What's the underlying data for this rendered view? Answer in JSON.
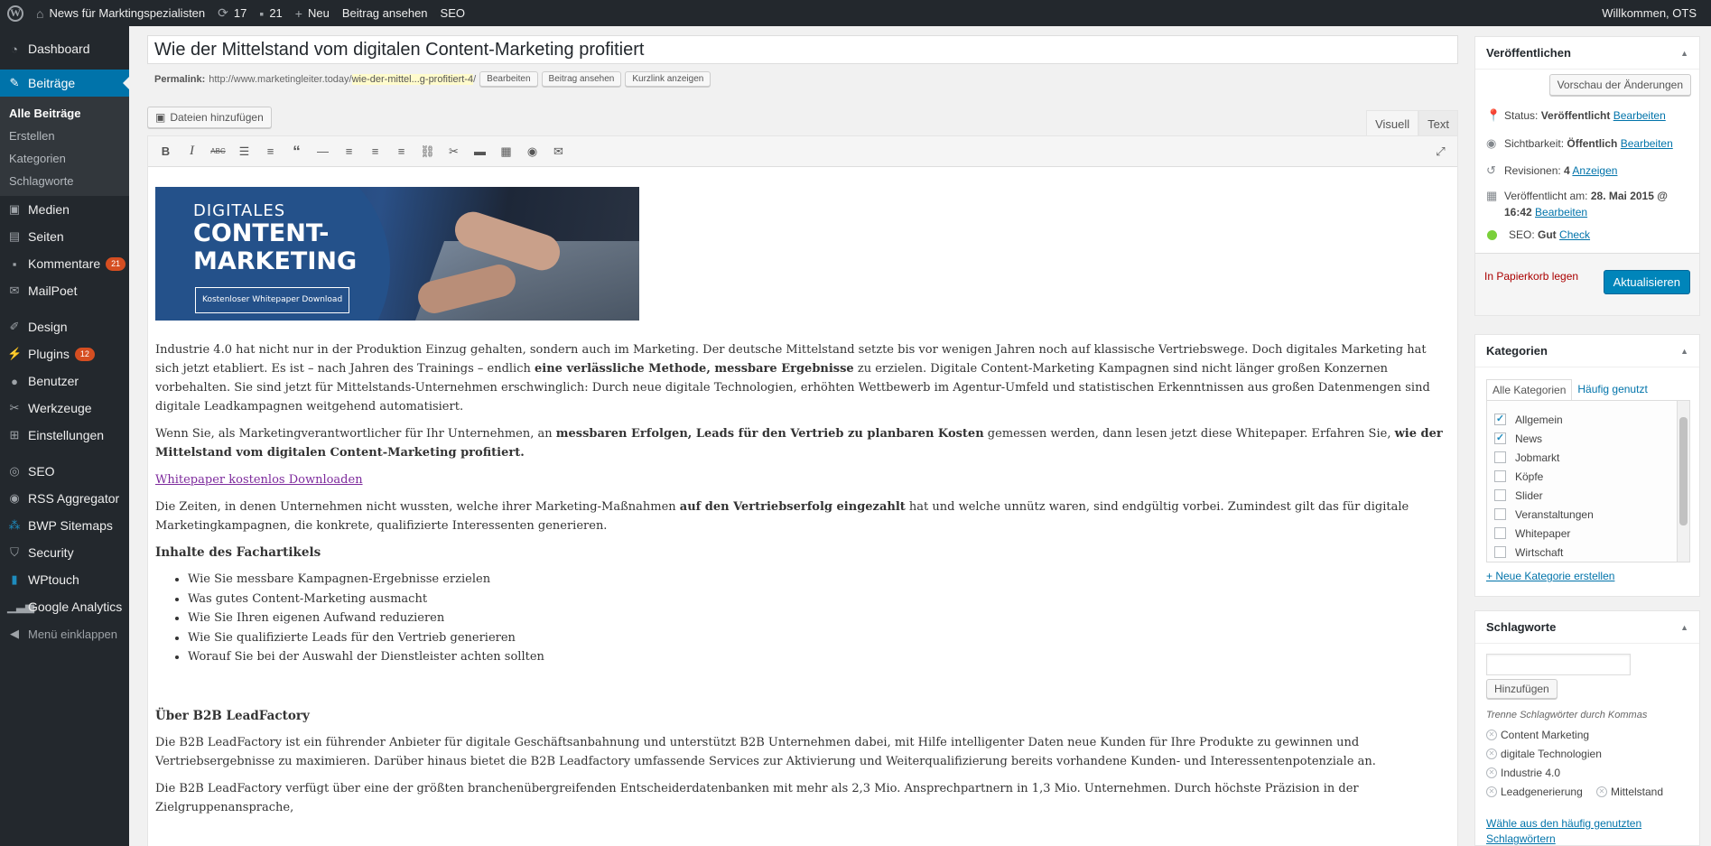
{
  "adminbar": {
    "site_name": "News für Marktingspezialisten",
    "updates_count": "17",
    "comments_count": "21",
    "new_label": "Neu",
    "view_post_label": "Beitrag ansehen",
    "seo_label": "SEO",
    "greeting": "Willkommen, OTS"
  },
  "sidebar": {
    "dashboard": "Dashboard",
    "posts": "Beiträge",
    "posts_sub": [
      "Alle Beiträge",
      "Erstellen",
      "Kategorien",
      "Schlagworte"
    ],
    "media": "Medien",
    "pages": "Seiten",
    "comments": "Kommentare",
    "comments_badge": "21",
    "mailpoet": "MailPoet",
    "design": "Design",
    "plugins": "Plugins",
    "plugins_badge": "12",
    "users": "Benutzer",
    "tools": "Werkzeuge",
    "settings": "Einstellungen",
    "seo": "SEO",
    "rss": "RSS Aggregator",
    "bwp": "BWP Sitemaps",
    "security": "Security",
    "wptouch": "WPtouch",
    "analytics": "Google Analytics",
    "collapse": "Menü einklappen"
  },
  "editor": {
    "title": "Wie der Mittelstand vom digitalen Content-Marketing profitiert",
    "permalink_label": "Permalink:",
    "permalink_base": "http://www.marketingleiter.today/",
    "permalink_slug": "wie-der-mittel...g-profitiert-4",
    "permalink_end": "/",
    "edit_btn": "Bearbeiten",
    "view_btn": "Beitrag ansehen",
    "shortlink_btn": "Kurzlink anzeigen",
    "add_media": "Dateien hinzufügen",
    "tab_visual": "Visuell",
    "tab_text": "Text"
  },
  "banner": {
    "line1": "DIGITALES",
    "line2": "CONTENT-",
    "line3": "MARKETING",
    "button": "Kostenloser Whitepaper Download"
  },
  "content": {
    "p1": "Industrie 4.0 hat nicht nur in der Produktion Einzug gehalten, sondern auch im Marketing. Der deutsche Mittelstand setzte bis vor wenigen Jahren noch auf klassische Vertriebswege. Doch digitales Marketing hat sich jetzt etabliert. Es ist – nach Jahren des Trainings – endlich ",
    "p1_bold": "eine verlässliche Methode, messbare Ergebnisse",
    "p1_end": " zu erzielen.  Digitale Content-Marketing Kampagnen sind nicht länger großen Konzernen vorbehalten. Sie sind jetzt für Mittelstands-Unternehmen erschwinglich: Durch neue digitale Technologien, erhöhten Wettbewerb im Agentur-Umfeld und statistischen Erkenntnissen aus großen Datenmengen sind digitale Leadkampagnen weitgehend automatisiert.",
    "p2_start": "Wenn Sie, als Marketingverantwortlicher für Ihr Unternehmen, an ",
    "p2_bold1": "messbaren Erfolgen, Leads für den Vertrieb zu planbaren Kosten",
    "p2_mid": " gemessen werden, dann lesen jetzt diese Whitepaper. Erfahren Sie, ",
    "p2_bold2": "wie der Mittelstand vom digitalen Content-Marketing profitiert.",
    "download_link": "Whitepaper kostenlos Downloaden",
    "p3_start": "Die Zeiten, in denen Unternehmen nicht wussten, welche ihrer Marketing-Maßnahmen ",
    "p3_bold": "auf den Vertriebserfolg eingezahlt",
    "p3_end": " hat und welche unnütz waren, sind endgültig vorbei. Zumindest gilt das für digitale Marketingkampagnen, die konkrete, qualifizierte Interessenten generieren.",
    "h_contents": "Inhalte des Fachartikels",
    "list": [
      "Wie Sie messbare Kampagnen-Ergebnisse erzielen",
      "Was gutes Content-Marketing ausmacht",
      "Wie Sie Ihren eigenen Aufwand reduzieren",
      "Wie Sie qualifizierte Leads für den Vertrieb generieren",
      "Worauf Sie bei der Auswahl der Dienstleister achten sollten"
    ],
    "h_about": "Über B2B LeadFactory",
    "p4": "Die B2B LeadFactory ist ein führender Anbieter für digitale Geschäftsanbahnung und unterstützt B2B Unternehmen dabei, mit Hilfe intelligenter Daten neue Kunden für Ihre Produkte zu gewinnen und Vertriebsergebnisse zu maximieren. Darüber hinaus bietet die B2B Leadfactory umfassende Services zur Aktivierung und Weiterqualifizierung bereits vorhandene Kunden- und Interessentenpotenziale an.",
    "p5": "Die B2B LeadFactory verfügt über eine der größten branchenübergreifenden Entscheiderdatenbanken mit mehr als 2,3 Mio. Ansprechpartnern in 1,3 Mio. Unternehmen. Durch höchste Präzision in der Zielgruppenansprache,"
  },
  "publish": {
    "title": "Veröffentlichen",
    "preview_btn": "Vorschau der Änderungen",
    "status_label": "Status: ",
    "status_value": "Veröffentlicht",
    "visibility_label": "Sichtbarkeit: ",
    "visibility_value": "Öffentlich",
    "revisions_label": "Revisionen: ",
    "revisions_value": "4",
    "revisions_link": "Anzeigen",
    "published_label": "Veröffentlicht am: ",
    "published_date": "28. Mai 2015 @",
    "published_time": "16:42",
    "seo_label": "SEO: ",
    "seo_value": "Gut",
    "seo_link": "Check",
    "edit_link": "Bearbeiten",
    "trash": "In Papierkorb legen",
    "update_btn": "Aktualisieren"
  },
  "categories": {
    "title": "Kategorien",
    "tab_all": "Alle Kategorien",
    "tab_popular": "Häufig genutzt",
    "items": [
      {
        "label": "Allgemein",
        "checked": "✓"
      },
      {
        "label": "News",
        "checked": "✓"
      },
      {
        "label": "Jobmarkt",
        "checked": ""
      },
      {
        "label": "Köpfe",
        "checked": ""
      },
      {
        "label": "Slider",
        "checked": ""
      },
      {
        "label": "Veranstaltungen",
        "checked": ""
      },
      {
        "label": "Whitepaper",
        "checked": ""
      },
      {
        "label": "Wirtschaft",
        "checked": ""
      }
    ],
    "new_link": "+ Neue Kategorie erstellen"
  },
  "tags": {
    "title": "Schlagworte",
    "add_btn": "Hinzufügen",
    "hint": "Trenne Schlagwörter durch Kommas",
    "items": [
      "Content Marketing",
      "digitale Technologien",
      "Industrie 4.0",
      "Leadgenerierung",
      "Mittelstand"
    ],
    "cloud_link_line1": "Wähle aus den häufig genutzten",
    "cloud_link_line2": "Schlagwörtern"
  },
  "colors": {
    "adminbar_bg": "#23282d",
    "menu_active": "#0073aa",
    "primary_button": "#0085ba",
    "link": "#0073aa",
    "seo_good": "#7ad03a",
    "badge": "#d54e21"
  }
}
